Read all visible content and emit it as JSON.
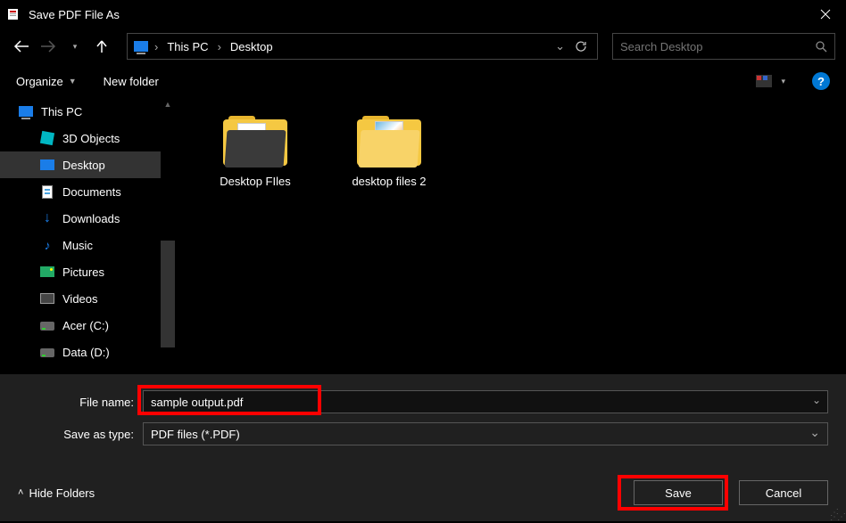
{
  "title": "Save PDF File As",
  "nav": {
    "back_enabled": true,
    "fwd_enabled": false,
    "history_chevron": "▾",
    "up_enabled": true
  },
  "address": {
    "seg1": "This PC",
    "seg2": "Desktop",
    "refresh_dropdown": "⌄"
  },
  "search": {
    "placeholder": "Search Desktop"
  },
  "toolbar": {
    "organize": "Organize",
    "newfolder": "New folder",
    "view_chevron": "▾"
  },
  "tree": {
    "root": "This PC",
    "items": [
      {
        "label": "3D Objects",
        "icon": "3d"
      },
      {
        "label": "Desktop",
        "icon": "desk",
        "selected": true
      },
      {
        "label": "Documents",
        "icon": "doc"
      },
      {
        "label": "Downloads",
        "icon": "dl"
      },
      {
        "label": "Music",
        "icon": "music"
      },
      {
        "label": "Pictures",
        "icon": "pic"
      },
      {
        "label": "Videos",
        "icon": "vid"
      },
      {
        "label": "Acer (C:)",
        "icon": "drv"
      },
      {
        "label": "Data (D:)",
        "icon": "drv"
      }
    ]
  },
  "content": {
    "folders": [
      {
        "label": "Desktop FIles"
      },
      {
        "label": "desktop files 2"
      }
    ]
  },
  "fields": {
    "filename_label": "File name:",
    "filename_value": "sample output.pdf",
    "savetype_label": "Save as type:",
    "savetype_value": "PDF files (*.PDF)"
  },
  "footer": {
    "hide": "Hide Folders",
    "save": "Save",
    "cancel": "Cancel"
  },
  "colors": {
    "highlight": "#ff0000",
    "accent": "#0078d4"
  }
}
